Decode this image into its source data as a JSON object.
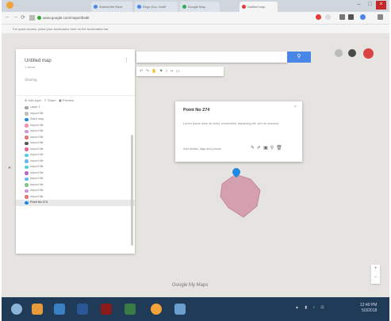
{
  "browser": {
    "tabs": [
      {
        "label": "Shared file Rave"
      },
      {
        "label": "Regs Doc: Untitl"
      },
      {
        "label": "Google Map"
      },
      {
        "label": "Untitled map"
      }
    ],
    "url": "www.google.com/maps/d/edit",
    "bookmarks_hint": "For quick access, place your bookmarks here on the bookmarks bar."
  },
  "panel": {
    "title": "Untitled map",
    "subtitle": "1 views",
    "share": "Sharing",
    "tools": [
      "Add layer",
      "Share",
      "Preview"
    ],
    "layers": [
      {
        "label": "Layer 1",
        "color": "#9e9e9e"
      },
      {
        "label": "Import file",
        "color": "#bdbdbd"
      },
      {
        "label": "Ward map",
        "color": "#1e88e5"
      },
      {
        "label": "Import file",
        "color": "#f48fb1"
      },
      {
        "label": "Import file",
        "color": "#ce93d8"
      },
      {
        "label": "Import file",
        "color": "#e57373"
      },
      {
        "label": "Import file",
        "color": "#555555"
      },
      {
        "label": "Import file",
        "color": "#f06292"
      },
      {
        "label": "Import file",
        "color": "#4dd0e1"
      },
      {
        "label": "Import file",
        "color": "#64b5f6"
      },
      {
        "label": "Import file",
        "color": "#4dd0e1"
      },
      {
        "label": "Import file",
        "color": "#ba68c8"
      },
      {
        "label": "Import file",
        "color": "#64b5f6"
      },
      {
        "label": "Import file",
        "color": "#81c784"
      },
      {
        "label": "Import file",
        "color": "#ce93d8"
      },
      {
        "label": "Import file",
        "color": "#e57373"
      },
      {
        "label": "Point No 274",
        "color": "#1e88e5"
      }
    ]
  },
  "map": {
    "search_placeholder": "",
    "search_icon": "magnifier-icon",
    "popup": {
      "title": "Point No 274",
      "description": "Lorem ipsum dolor sit amet, consectetur adipiscing elit, sed do eiusmod.",
      "footer": "Add details, tags and photos"
    },
    "logo": "Google My Maps",
    "polygon_color": "#d4a0b0",
    "pin_color": "#1e88e5"
  },
  "taskbar": {
    "time": "12:40 PM",
    "date": "5/3/2018"
  }
}
